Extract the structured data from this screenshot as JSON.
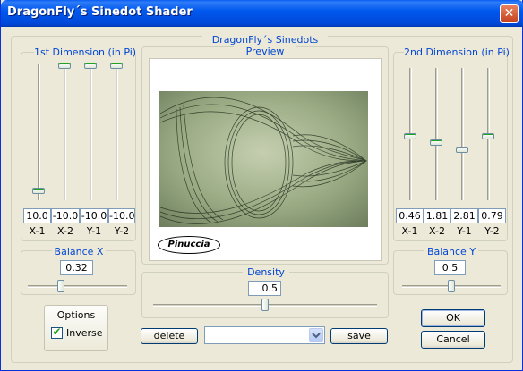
{
  "window": {
    "title": "DragonFly´s Sinedot Shader",
    "close_glyph": "✕"
  },
  "center": {
    "title_line1": "DragonFly´s Sinedots",
    "title_line2": "Preview",
    "watermark": "Pinuccia"
  },
  "dim1": {
    "title": "1st Dimension (in Pi)",
    "sliders": [
      {
        "label": "X-1",
        "value": "10.0",
        "level": 0.93
      },
      {
        "label": "X-2",
        "value": "-10.0",
        "level": 0.0
      },
      {
        "label": "Y-1",
        "value": "-10.0",
        "level": 0.0
      },
      {
        "label": "Y-2",
        "value": "-10.0",
        "level": 0.0
      }
    ]
  },
  "dim2": {
    "title": "2nd Dimension (in Pi)",
    "sliders": [
      {
        "label": "X-1",
        "value": "0.46",
        "level": 0.52
      },
      {
        "label": "X-2",
        "value": "1.81",
        "level": 0.57
      },
      {
        "label": "Y-1",
        "value": "2.81",
        "level": 0.62
      },
      {
        "label": "Y-2",
        "value": "0.79",
        "level": 0.52
      }
    ]
  },
  "balance_x": {
    "label": "Balance X",
    "value": "0.32",
    "level": 0.32
  },
  "balance_y": {
    "label": "Balance Y",
    "value": "0.5",
    "level": 0.5
  },
  "density": {
    "label": "Density",
    "value": "0.5",
    "level": 0.5
  },
  "options": {
    "title": "Options",
    "inverse_label": "Inverse",
    "inverse_checked": true
  },
  "buttons": {
    "delete": "delete",
    "save": "save",
    "ok": "OK",
    "cancel": "Cancel"
  },
  "preset": {
    "value": ""
  },
  "colors": {
    "accent": "#0046d5",
    "titlebar": "#0058ee",
    "face": "#ece9d8",
    "check": "#21a121"
  }
}
